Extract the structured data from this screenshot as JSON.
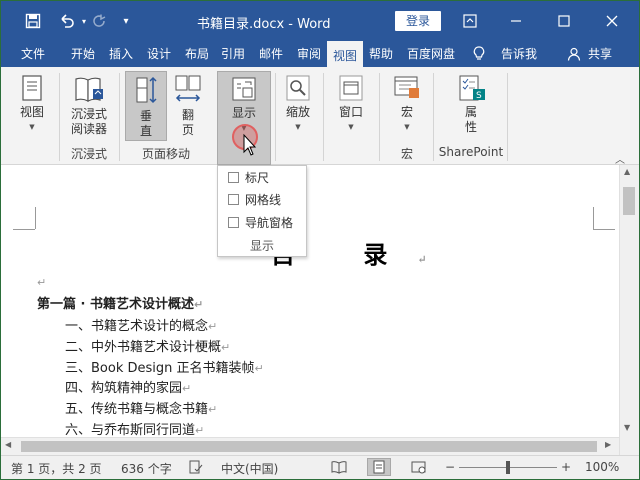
{
  "window": {
    "title": "书籍目录.docx  -  Word",
    "login_label": "登录"
  },
  "tabs": [
    {
      "label": "文件"
    },
    {
      "label": "开始"
    },
    {
      "label": "插入"
    },
    {
      "label": "设计"
    },
    {
      "label": "布局"
    },
    {
      "label": "引用"
    },
    {
      "label": "邮件"
    },
    {
      "label": "审阅"
    },
    {
      "label": "视图"
    },
    {
      "label": "帮助"
    },
    {
      "label": "百度网盘"
    },
    {
      "label": "告诉我"
    },
    {
      "label": "共享"
    }
  ],
  "ribbon": {
    "view_label": "视图",
    "immersive_reader_label1": "沉浸式",
    "immersive_reader_label2": "阅读器",
    "group_immersive": "沉浸式",
    "vertical_label1": "垂",
    "vertical_label2": "直",
    "page_flip_label1": "翻",
    "page_flip_label2": "页",
    "group_page_move": "页面移动",
    "show_label": "显示",
    "zoom_label": "缩放",
    "window_label": "窗口",
    "macro_label": "宏",
    "group_macro": "宏",
    "properties_label1": "属",
    "properties_label2": "性",
    "group_sharepoint": "SharePoint"
  },
  "dropdown": {
    "items": [
      {
        "label": "标尺",
        "checked": false
      },
      {
        "label": "网格线",
        "checked": false
      },
      {
        "label": "导航窗格",
        "checked": false
      }
    ],
    "footer": "显示"
  },
  "document": {
    "heading": "目 录",
    "lines": [
      {
        "text": "第一篇 · 书籍艺术设计概述",
        "bold": true
      },
      {
        "text": "一、书籍艺术设计的概念",
        "bold": false
      },
      {
        "text": "二、中外书籍艺术设计梗概",
        "bold": false
      },
      {
        "text": "三、Book Design 正名书籍装帧",
        "bold": false
      },
      {
        "text": "四、构筑精神的家园",
        "bold": false
      },
      {
        "text": "五、传统书籍与概念书籍",
        "bold": false
      },
      {
        "text": "六、与乔布斯同行同道",
        "bold": false
      }
    ]
  },
  "status": {
    "page": "第 1 页，共 2 页",
    "words": "636 个字",
    "language": "中文(中国)",
    "zoom": "100%",
    "zoom_minus": "−",
    "zoom_plus": "+"
  }
}
